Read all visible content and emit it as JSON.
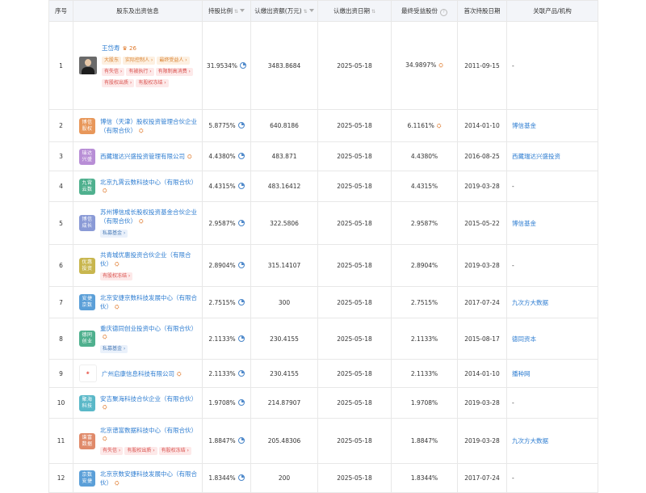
{
  "headers": {
    "idx": "序号",
    "name": "股东及出资信息",
    "ratio": "持股比例",
    "amount": "认缴出资额(万元)",
    "date": "认缴出资日期",
    "benefit": "最终受益股份",
    "first": "首次持股日期",
    "related": "关联产品/机构"
  },
  "rows": [
    {
      "idx": "1",
      "name": "王岱寿",
      "crown": "26",
      "logo": "",
      "ratio": "31.9534%",
      "amount": "3483.8684",
      "date": "2025-05-18",
      "benefit": "34.9897%",
      "first": "2011-09-15",
      "related": "-",
      "tags": [
        {
          "text": "大股东",
          "style": "orange"
        },
        {
          "text": "实际控制人 ›",
          "style": "orange"
        },
        {
          "text": "最终受益人 ›",
          "style": "orange"
        },
        {
          "text": "有失信 ›",
          "style": "red"
        },
        {
          "text": "有被执行 ›",
          "style": "red"
        },
        {
          "text": "有限制高消费 ›",
          "style": "red"
        },
        {
          "text": "有股权出质 ›",
          "style": "red"
        },
        {
          "text": "有股权冻结 ›",
          "style": "red"
        }
      ]
    },
    {
      "idx": "2",
      "name": "博信（天津）股权投资管理合伙企业（有限合伙）",
      "logo": "博信股权",
      "logo_color": "#e8975a",
      "ratio": "5.8775%",
      "amount": "640.8186",
      "date": "2025-05-18",
      "benefit": "6.1161%",
      "first": "2014-01-10",
      "related": "博信基金",
      "tags": []
    },
    {
      "idx": "3",
      "name": "西藏瑞达兴盛投资管理有限公司",
      "logo": "瑞达兴盛",
      "logo_color": "#b88ed6",
      "ratio": "4.4380%",
      "amount": "483.871",
      "date": "2025-05-18",
      "benefit": "4.4380%",
      "first": "2016-08-25",
      "related": "西藏瑞达兴盛投资",
      "tags": []
    },
    {
      "idx": "4",
      "name": "北京九霄云数科技中心（有限合伙）",
      "logo": "九霄云数",
      "logo_color": "#4fb08e",
      "ratio": "4.4315%",
      "amount": "483.16412",
      "date": "2025-05-18",
      "benefit": "4.4315%",
      "first": "2019-03-28",
      "related": "-",
      "tags": []
    },
    {
      "idx": "5",
      "name": "苏州博信成长股权投资基金合伙企业（有限合伙）",
      "logo": "博信成长",
      "logo_color": "#8a9ad6",
      "ratio": "2.9587%",
      "amount": "322.5806",
      "date": "2025-05-18",
      "benefit": "2.9587%",
      "first": "2015-05-22",
      "related": "博信基金",
      "tags": [
        {
          "text": "私募基金 ›",
          "style": "blue"
        }
      ]
    },
    {
      "idx": "6",
      "name": "共青城优惠投资合伙企业（有限合伙）",
      "logo": "优惠投资",
      "logo_color": "#c8b64e",
      "ratio": "2.8904%",
      "amount": "315.14107",
      "date": "2025-05-18",
      "benefit": "2.8904%",
      "first": "2019-03-28",
      "related": "-",
      "tags": [
        {
          "text": "有股权冻结 ›",
          "style": "red"
        }
      ]
    },
    {
      "idx": "7",
      "name": "北京安捷京数科技发展中心（有限合伙）",
      "logo": "安捷京数",
      "logo_color": "#5b9fd8",
      "ratio": "2.7515%",
      "amount": "300",
      "date": "2025-05-18",
      "benefit": "2.7515%",
      "first": "2017-07-24",
      "related": "九次方大数据",
      "tags": []
    },
    {
      "idx": "8",
      "name": "重庆德同创业投资中心（有限合伙）",
      "logo": "德同创业",
      "logo_color": "#4fb08e",
      "ratio": "2.1133%",
      "amount": "230.4155",
      "date": "2025-05-18",
      "benefit": "2.1133%",
      "first": "2015-08-17",
      "related": "德同资本",
      "tags": [
        {
          "text": "私募基金 ›",
          "style": "blue"
        }
      ]
    },
    {
      "idx": "9",
      "name": "广州启康信息科技有限公司",
      "logo": "",
      "logo_img": true,
      "ratio": "2.1133%",
      "amount": "230.4155",
      "date": "2025-05-18",
      "benefit": "2.1133%",
      "first": "2014-01-10",
      "related": "播种网",
      "tags": []
    },
    {
      "idx": "10",
      "name": "安吉聚海科技合伙企业（有限合伙）",
      "logo": "聚海科技",
      "logo_color": "#5ab8c8",
      "ratio": "1.9708%",
      "amount": "214.87907",
      "date": "2025-05-18",
      "benefit": "1.9708%",
      "first": "2019-03-28",
      "related": "-",
      "tags": []
    },
    {
      "idx": "11",
      "name": "北京谱富数据科技中心（有限合伙）",
      "logo": "谱富数据",
      "logo_color": "#e08a6a",
      "ratio": "1.8847%",
      "amount": "205.48306",
      "date": "2025-05-18",
      "benefit": "1.8847%",
      "first": "2019-03-28",
      "related": "九次方大数据",
      "tags": [
        {
          "text": "有失信 ›",
          "style": "red"
        },
        {
          "text": "有股权出质 ›",
          "style": "red"
        },
        {
          "text": "有股权冻结 ›",
          "style": "red"
        }
      ]
    },
    {
      "idx": "12",
      "name": "北京京数安捷科技发展中心（有限合伙）",
      "logo": "京数安捷",
      "logo_color": "#5b9fd8",
      "ratio": "1.8344%",
      "amount": "200",
      "date": "2025-05-18",
      "benefit": "1.8344%",
      "first": "2017-07-24",
      "related": "-",
      "tags": []
    }
  ]
}
